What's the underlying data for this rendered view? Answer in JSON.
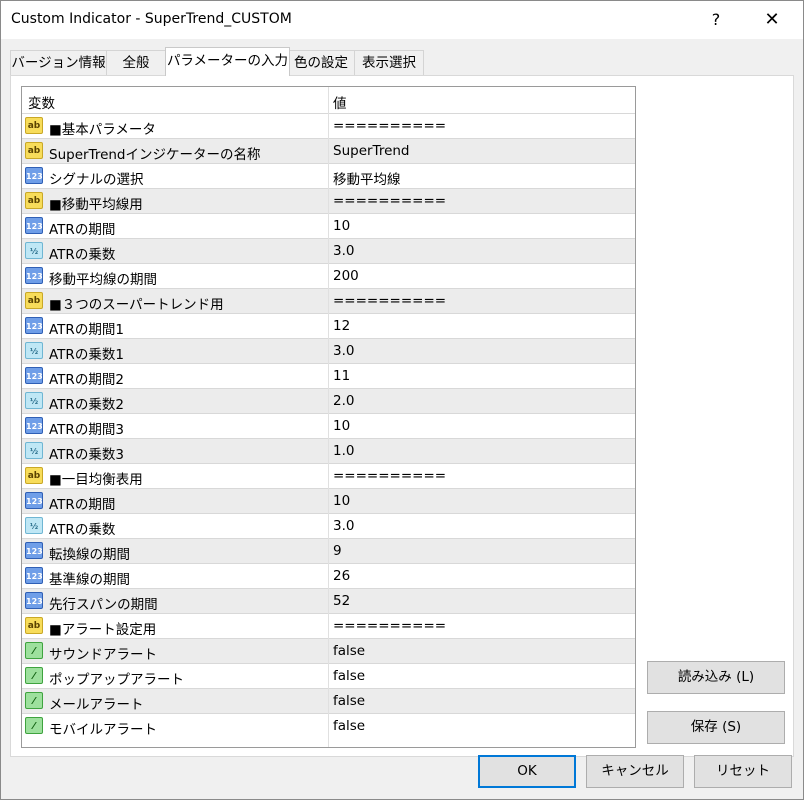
{
  "window": {
    "title": "Custom Indicator - SuperTrend_CUSTOM",
    "help": "?",
    "close": "✕"
  },
  "tabs": [
    "バージョン情報",
    "全般",
    "パラメーターの入力",
    "色の設定",
    "表示選択"
  ],
  "grid": {
    "col_name": "変数",
    "col_value": "値",
    "rows": [
      {
        "type": "ab",
        "name": "■基本パラメータ",
        "value": "=========="
      },
      {
        "type": "ab",
        "name": "SuperTrendインジケーターの名称",
        "value": "SuperTrend"
      },
      {
        "type": "int",
        "name": "シグナルの選択",
        "value": "移動平均線"
      },
      {
        "type": "ab",
        "name": "■移動平均線用",
        "value": "=========="
      },
      {
        "type": "int",
        "name": "ATRの期間",
        "value": "10"
      },
      {
        "type": "dbl",
        "name": "ATRの乗数",
        "value": "3.0"
      },
      {
        "type": "int",
        "name": "移動平均線の期間",
        "value": "200"
      },
      {
        "type": "ab",
        "name": "■３つのスーパートレンド用",
        "value": "=========="
      },
      {
        "type": "int",
        "name": "ATRの期間1",
        "value": "12"
      },
      {
        "type": "dbl",
        "name": "ATRの乗数1",
        "value": "3.0"
      },
      {
        "type": "int",
        "name": "ATRの期間2",
        "value": "11"
      },
      {
        "type": "dbl",
        "name": "ATRの乗数2",
        "value": "2.0"
      },
      {
        "type": "int",
        "name": "ATRの期間3",
        "value": "10"
      },
      {
        "type": "dbl",
        "name": "ATRの乗数3",
        "value": "1.0"
      },
      {
        "type": "ab",
        "name": "■一目均衡表用",
        "value": "=========="
      },
      {
        "type": "int",
        "name": "ATRの期間",
        "value": "10"
      },
      {
        "type": "dbl",
        "name": "ATRの乗数",
        "value": "3.0"
      },
      {
        "type": "int",
        "name": "転換線の期間",
        "value": "9"
      },
      {
        "type": "int",
        "name": "基準線の期間",
        "value": "26"
      },
      {
        "type": "int",
        "name": "先行スパンの期間",
        "value": "52"
      },
      {
        "type": "ab",
        "name": "■アラート設定用",
        "value": "=========="
      },
      {
        "type": "bool",
        "name": "サウンドアラート",
        "value": "false"
      },
      {
        "type": "bool",
        "name": "ポップアップアラート",
        "value": "false"
      },
      {
        "type": "bool",
        "name": "メールアラート",
        "value": "false"
      },
      {
        "type": "bool",
        "name": "モバイルアラート",
        "value": "false"
      }
    ]
  },
  "icons": {
    "ab": "ab",
    "int": "123",
    "dbl": "½",
    "bool": "⁄"
  },
  "buttons": {
    "load": "読み込み (L)",
    "save": "保存 (S)",
    "ok": "OK",
    "cancel": "キャンセル",
    "reset": "リセット"
  }
}
